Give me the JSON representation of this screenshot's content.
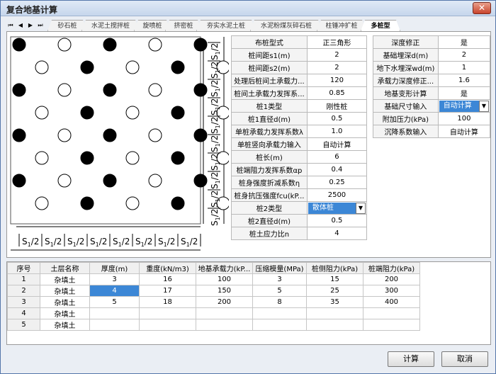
{
  "window": {
    "title": "复合地基计算",
    "close_glyph": "✕"
  },
  "tabs": {
    "nav": [
      "⏮",
      "◀",
      "▶",
      "⏭"
    ],
    "items": [
      "砂石桩",
      "水泥土搅拌桩",
      "旋喷桩",
      "挤密桩",
      "夯实水泥土桩",
      "水泥粉煤灰碎石桩",
      "柱锤冲扩桩",
      "多桩型"
    ],
    "active": "多桩型"
  },
  "figure": {
    "layout": "正三角形 triangular pile grid",
    "rows": 8,
    "piles_per_row": 5,
    "pile1_marker": "solid black circle",
    "pile2_marker": "hollow circle",
    "spacing_label_num": "S",
    "spacing_label_sub": "1",
    "spacing_label_den": "2",
    "horizontal_label_count": 8,
    "vertical_label_count": 10
  },
  "pile_params": [
    {
      "label": "布桩型式",
      "value": "正三角形"
    },
    {
      "label": "桩间距s1(m)",
      "value": "2"
    },
    {
      "label": "桩间距s2(m)",
      "value": "2"
    },
    {
      "label": "处理后桩间土承载力...",
      "value": "120"
    },
    {
      "label": "桩间土承载力发挥系...",
      "value": "0.85"
    },
    {
      "label": "桩1类型",
      "value": "刚性桩"
    },
    {
      "label": "桩1直径d(m)",
      "value": "0.5"
    },
    {
      "label": "单桩承载力发挥系数λ",
      "value": "1.0"
    },
    {
      "label": "单桩竖向承载力输入",
      "value": "自动计算"
    },
    {
      "label": "桩长(m)",
      "value": "6"
    },
    {
      "label": "桩端阻力发挥系数αp",
      "value": "0.4"
    },
    {
      "label": "桩身强度折减系数η",
      "value": "0.25"
    },
    {
      "label": "桩身抗压强度fcu(kP...",
      "value": "2500"
    },
    {
      "label": "桩2类型",
      "value": "散体桩"
    },
    {
      "label": "桩2直径d(m)",
      "value": "0.5"
    },
    {
      "label": "桩土应力比n",
      "value": "4"
    }
  ],
  "depth_params": [
    {
      "label": "深度修正",
      "value": "是"
    },
    {
      "label": "基础埋深d(m)",
      "value": "2"
    },
    {
      "label": "地下水埋深wd(m)",
      "value": "1"
    },
    {
      "label": "承载力深度修正...",
      "value": "1.6"
    },
    {
      "label": "地基变形计算",
      "value": "是"
    },
    {
      "label": "基础尺寸输入",
      "value": "自动计算"
    },
    {
      "label": "附加压力(kPa)",
      "value": "100"
    },
    {
      "label": "沉降系数输入",
      "value": "自动计算"
    }
  ],
  "dropdown_arrow": "▼",
  "soil_table": {
    "columns": [
      "序号",
      "土层名称",
      "厚度(m)",
      "重度(kN/m3)",
      "地基承载力(kP...",
      "压缩模量(MPa)",
      "桩侧阻力(kPa)",
      "桩端阻力(kPa)"
    ],
    "rows": [
      [
        "1",
        "杂填土",
        "3",
        "16",
        "100",
        "3",
        "15",
        "200"
      ],
      [
        "2",
        "杂填土",
        "4",
        "17",
        "150",
        "5",
        "25",
        "300"
      ],
      [
        "3",
        "杂填土",
        "5",
        "18",
        "200",
        "8",
        "35",
        "400"
      ],
      [
        "4",
        "杂填土",
        "",
        "",
        "",
        "",
        "",
        ""
      ],
      [
        "5",
        "杂填土",
        "",
        "",
        "",
        "",
        "",
        ""
      ]
    ],
    "selected": {
      "row": 1,
      "col": 2
    }
  },
  "buttons": {
    "calc": "计算",
    "cancel": "取消"
  },
  "colors": {
    "accent": "#3c87d6",
    "pile1": "#000000",
    "window": "#eaeef4"
  }
}
